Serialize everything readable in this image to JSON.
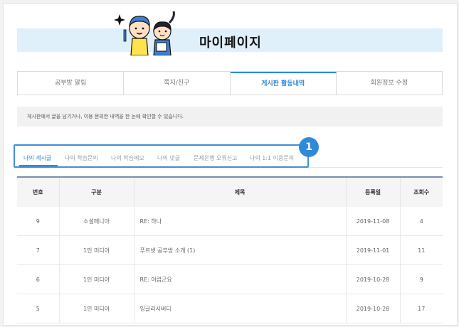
{
  "header": {
    "title": "마이페이지"
  },
  "main_tabs": [
    {
      "label": "공부방 알림"
    },
    {
      "label": "쪽지/친구"
    },
    {
      "label": "게시판 활동내역"
    },
    {
      "label": "회원정보 수정"
    }
  ],
  "notice": "게시판에서 글을 남기거나, 이용 문의한 내역을 한 눈에 확인할 수 있습니다.",
  "sub_tabs": [
    {
      "label": "나의 게시글"
    },
    {
      "label": "나의 학습문의"
    },
    {
      "label": "나의 학습메모"
    },
    {
      "label": "나의 댓글"
    },
    {
      "label": "문제은행 오류신고"
    },
    {
      "label": "나의 1:1 이용문의"
    }
  ],
  "badge": "1",
  "table": {
    "headers": {
      "no": "번호",
      "category": "구분",
      "title": "제목",
      "date": "등록일",
      "views": "조회수"
    },
    "rows": [
      {
        "no": "9",
        "category": "소셜매니아",
        "title": "RE: 하나",
        "date": "2019-11-08",
        "views": "4"
      },
      {
        "no": "7",
        "category": "1인 미디어",
        "title": "푸르넷 공부방 소개 (1)",
        "date": "2019-11-01",
        "views": "11"
      },
      {
        "no": "6",
        "category": "1인 미디어",
        "title": "RE: 어렵군요",
        "date": "2019-10-28",
        "views": "9"
      },
      {
        "no": "5",
        "category": "1인 미디어",
        "title": "잉글리시버디",
        "date": "2019-10-28",
        "views": "17"
      }
    ]
  },
  "colors": {
    "accent": "#2f8ad8",
    "banner": "#dff0fa"
  }
}
